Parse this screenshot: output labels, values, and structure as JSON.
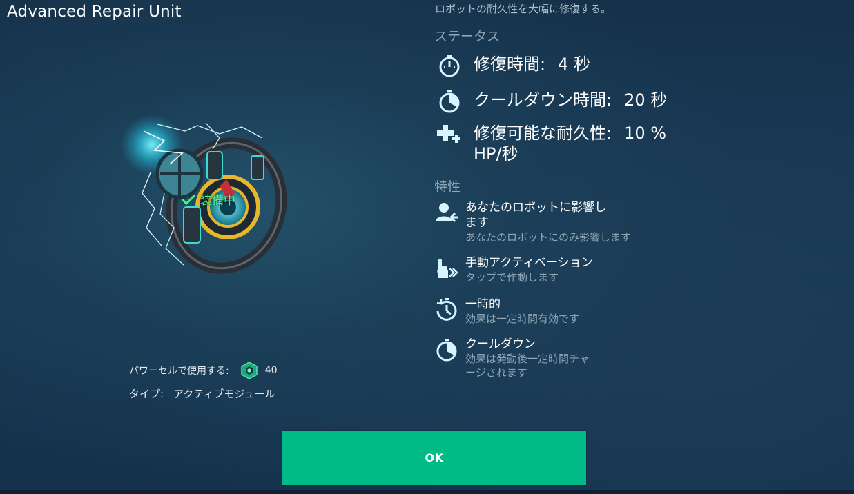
{
  "window": {
    "title": "Advanced Repair Unit"
  },
  "description": "ロボットの耐久性を大幅に修復する。",
  "status": {
    "heading": "ステータス",
    "items": [
      {
        "icon": "stopwatch-icon",
        "label": "修復時間:",
        "value": "4 秒"
      },
      {
        "icon": "cooldown-timer-icon",
        "label": "クールダウン時間:",
        "value": "20 秒"
      },
      {
        "icon": "repair-plus-icon",
        "label": "修復可能な耐久性:",
        "value": "10 % HP/秒"
      }
    ]
  },
  "traits": {
    "heading": "特性",
    "items": [
      {
        "icon": "user-self-icon",
        "title": "あなたのロボットに影響します",
        "subtitle": "あなたのロボットにのみ影響します"
      },
      {
        "icon": "tap-hand-icon",
        "title": "手動アクティベーション",
        "subtitle": "タップで作動します"
      },
      {
        "icon": "temporary-timer-icon",
        "title": "一時的",
        "subtitle": "効果は一定時間有効です"
      },
      {
        "icon": "cooldown-icon",
        "title": "クールダウン",
        "subtitle": "効果は発動後一定時間チャージされます"
      }
    ]
  },
  "module": {
    "image_icon": "repair-unit-image",
    "equipped_label": "装備中"
  },
  "info": {
    "power_cell_label": "パワーセルで使用する:",
    "power_cell_icon": "power-cell-icon",
    "power_cell_value": "40",
    "type_label": "タイプ:",
    "type_value": "アクティブモジュール"
  },
  "ok_button": {
    "label": "OK"
  },
  "colors": {
    "accent": "#00bb86",
    "icon": "#d8f4ff",
    "equipped": "#4cf08e",
    "muted_text": "#8fa6b6"
  }
}
